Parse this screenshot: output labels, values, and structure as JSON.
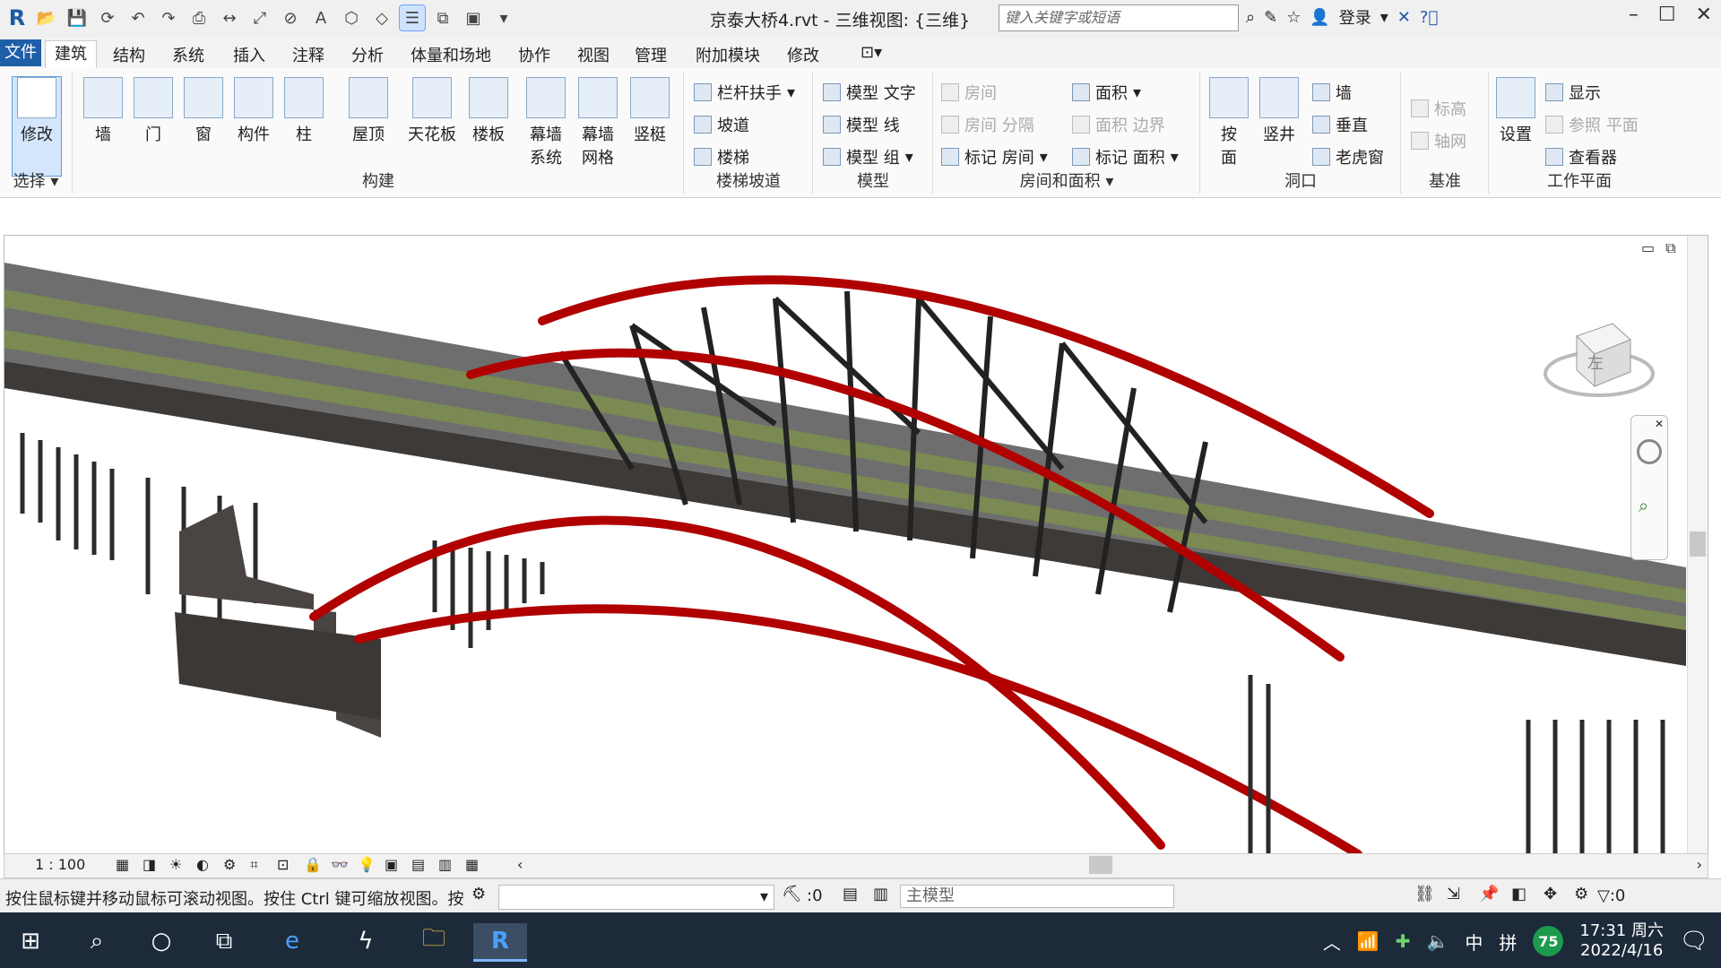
{
  "window": {
    "title": "京泰大桥4.rvt - 三维视图: {三维}",
    "search_placeholder": "键入关键字或短语",
    "login": "登录"
  },
  "menu": {
    "file": "文件",
    "tabs": [
      "建筑",
      "结构",
      "系统",
      "插入",
      "注释",
      "分析",
      "体量和场地",
      "协作",
      "视图",
      "管理",
      "附加模块",
      "修改"
    ]
  },
  "ribbon": {
    "select": {
      "modify": "修改",
      "label": "选择"
    },
    "build": {
      "label": "构建",
      "items": [
        "墙",
        "门",
        "窗",
        "构件",
        "柱",
        "屋顶",
        "天花板",
        "楼板",
        "幕墙\n系统",
        "幕墙\n网格",
        "竖梃"
      ]
    },
    "stairs": {
      "label": "楼梯坡道",
      "railing": "栏杆扶手",
      "ramp": "坡道",
      "stair": "楼梯"
    },
    "model": {
      "label": "模型",
      "text": "模型 文字",
      "line": "模型 线",
      "group": "模型 组"
    },
    "rooms": {
      "label": "房间和面积",
      "room": "房间",
      "room_sep": "房间 分隔",
      "tag_room": "标记 房间",
      "area": "面积",
      "area_boundary": "面积 边界",
      "tag_area": "标记 面积"
    },
    "opening": {
      "label": "洞口",
      "by_face": "按\n面",
      "shaft": "竖井",
      "wall": "墙",
      "vertical": "垂直",
      "dormer": "老虎窗"
    },
    "datum": {
      "label": "基准",
      "level": "标高",
      "grid": "轴网"
    },
    "workplane": {
      "label": "工作平面",
      "set": "设置",
      "show": "显示",
      "ref_plane": "参照 平面",
      "viewer": "查看器"
    }
  },
  "viewport": {
    "viewcube_face": "左"
  },
  "viewbar": {
    "scale": "1 : 100"
  },
  "status": {
    "message": "按住鼠标键并移动鼠标可滚动视图。按住 Ctrl 键可缩放视图。按",
    "select_count": ":0",
    "model": "主模型",
    "filter_count": ":0"
  },
  "taskbar": {
    "ime": "中",
    "ime2": "拼",
    "security_score": "75",
    "time": "17:31 周六",
    "date": "2022/4/16"
  },
  "colors": {
    "arch": "#b00000",
    "deck": "#6b7a4a",
    "steel": "#2b2b2b",
    "pier": "#4a4542"
  }
}
